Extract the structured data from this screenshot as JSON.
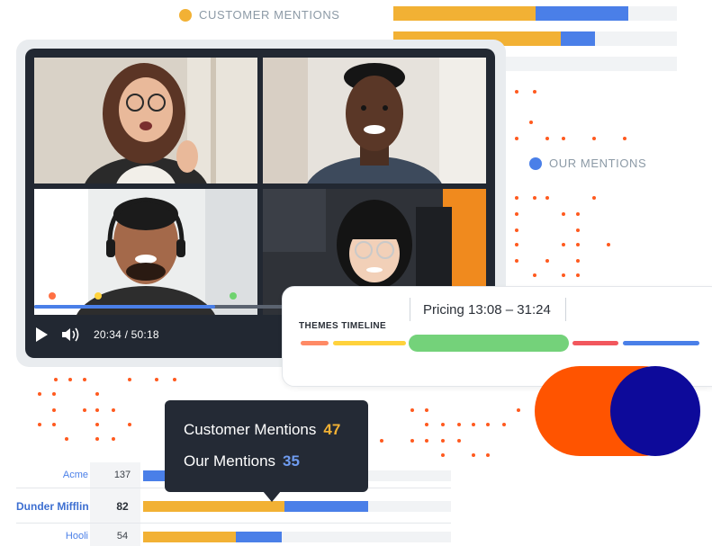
{
  "legend": {
    "customer_label": "CUSTOMER MENTIONS",
    "ours_label": "OUR MENTIONS",
    "customer_color": "#f2b134",
    "ours_color": "#4a7fe8"
  },
  "top_bars": [
    {
      "customer_share": 0.5,
      "ours_share": 0.33
    },
    {
      "customer_share": 0.59,
      "ours_share": 0.12
    },
    {
      "customer_share": 0.0,
      "ours_share": 0.19
    }
  ],
  "video": {
    "time_current": "20:34",
    "time_total": "50:18",
    "time_separator": "/",
    "progress": 0.4,
    "play_icon": "play-icon",
    "volume_icon": "volume-icon",
    "marker_colors": [
      "#ff7043",
      "#ffd23c",
      "#6fd36f"
    ]
  },
  "themes": {
    "title": "THEMES TIMELINE",
    "selected_theme": "Pricing",
    "range_start": "13:08",
    "range_end": "31:24",
    "range_separator": "–",
    "segments": [
      {
        "color": "#ff8a65"
      },
      {
        "color": "#ffd23c"
      },
      {
        "color": "#74d27a"
      },
      {
        "color": "#f2575d"
      },
      {
        "color": "#4a7fe8"
      }
    ]
  },
  "tooltip": {
    "customer_label": "Customer Mentions",
    "customer_value": "47",
    "ours_label": "Our Mentions",
    "ours_value": "35"
  },
  "ranking": [
    {
      "name": "Acme",
      "count": "137",
      "customer_share": 0.0,
      "ours_share": 0.27,
      "bold": false
    },
    {
      "name": "Dunder Mifflin",
      "count": "82",
      "customer_share": 0.46,
      "ours_share": 0.27,
      "bold": true
    },
    {
      "name": "Hooli",
      "count": "54",
      "customer_share": 0.3,
      "ours_share": 0.15,
      "bold": false
    }
  ],
  "accents": {
    "orange": "#ff5400",
    "navy": "#0d0a9a",
    "dot_color": "#ff5a1f"
  }
}
